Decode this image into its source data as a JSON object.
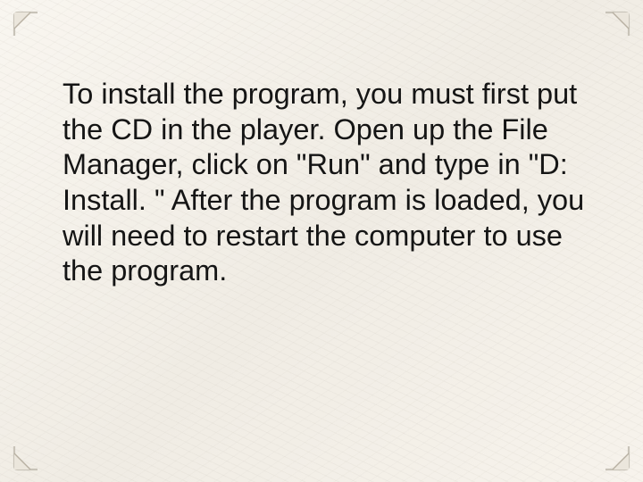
{
  "slide": {
    "body": "To install the program, you must first put the CD in the player. Open up the File Manager, click on \"Run\" and type in \"D: Install. \" After the program is loaded, you will need to restart the computer to use the program."
  }
}
